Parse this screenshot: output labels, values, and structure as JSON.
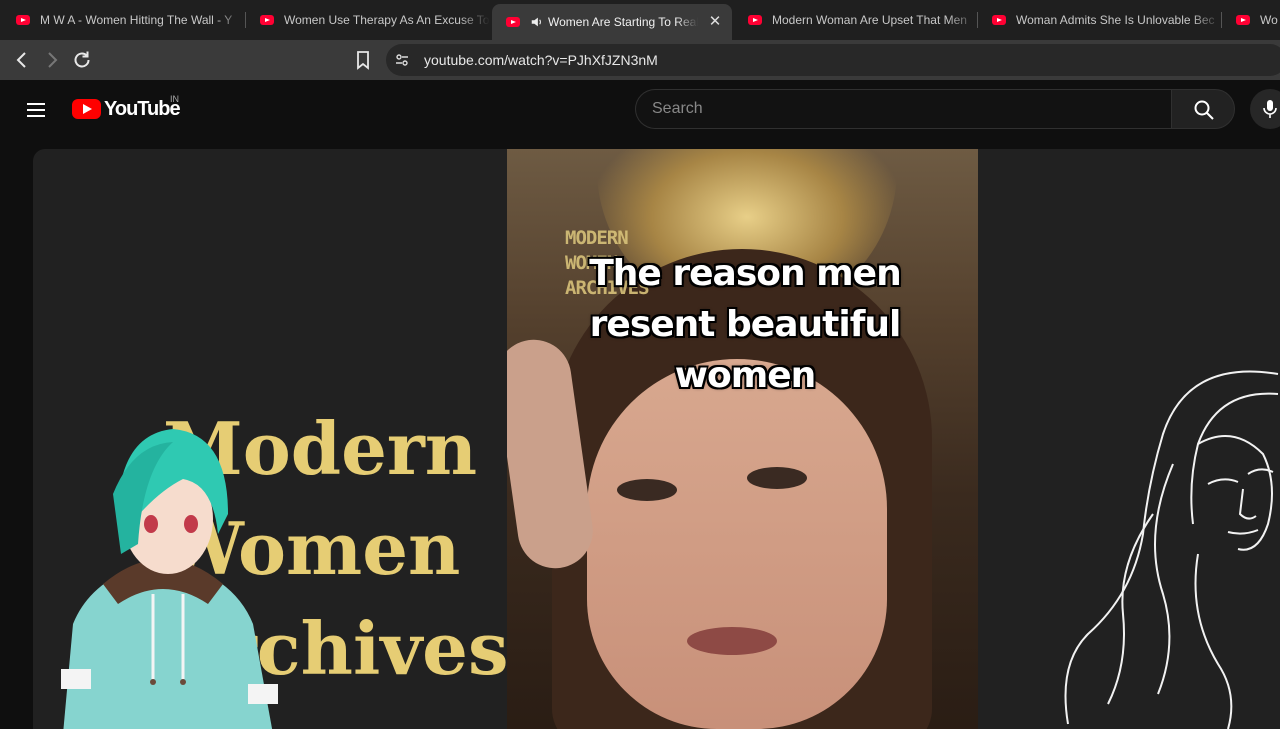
{
  "tabs": [
    {
      "title": "M W A - Women Hitting The Wall - Y",
      "active": false
    },
    {
      "title": "Women Use Therapy As An Excuse To",
      "active": false
    },
    {
      "title": "Women Are Starting To Realize",
      "active": true
    },
    {
      "title": "Modern Woman Are Upset That Men",
      "active": false
    },
    {
      "title": "Woman Admits She Is Unlovable Bec",
      "active": false
    },
    {
      "title": "Wo",
      "active": false
    }
  ],
  "address_bar": {
    "url": "youtube.com/watch?v=PJhXfJZN3nM"
  },
  "youtube": {
    "logo_text": "YouTube",
    "country_code": "IN",
    "search_placeholder": "Search"
  },
  "video": {
    "channel_watermark": "MODERN\nWOMEN\nARCHIVES",
    "caption": "The reason men resent beautiful women",
    "background_title": "Modern\nWomen\nArchives",
    "background_title_color": "#e6cd74"
  }
}
